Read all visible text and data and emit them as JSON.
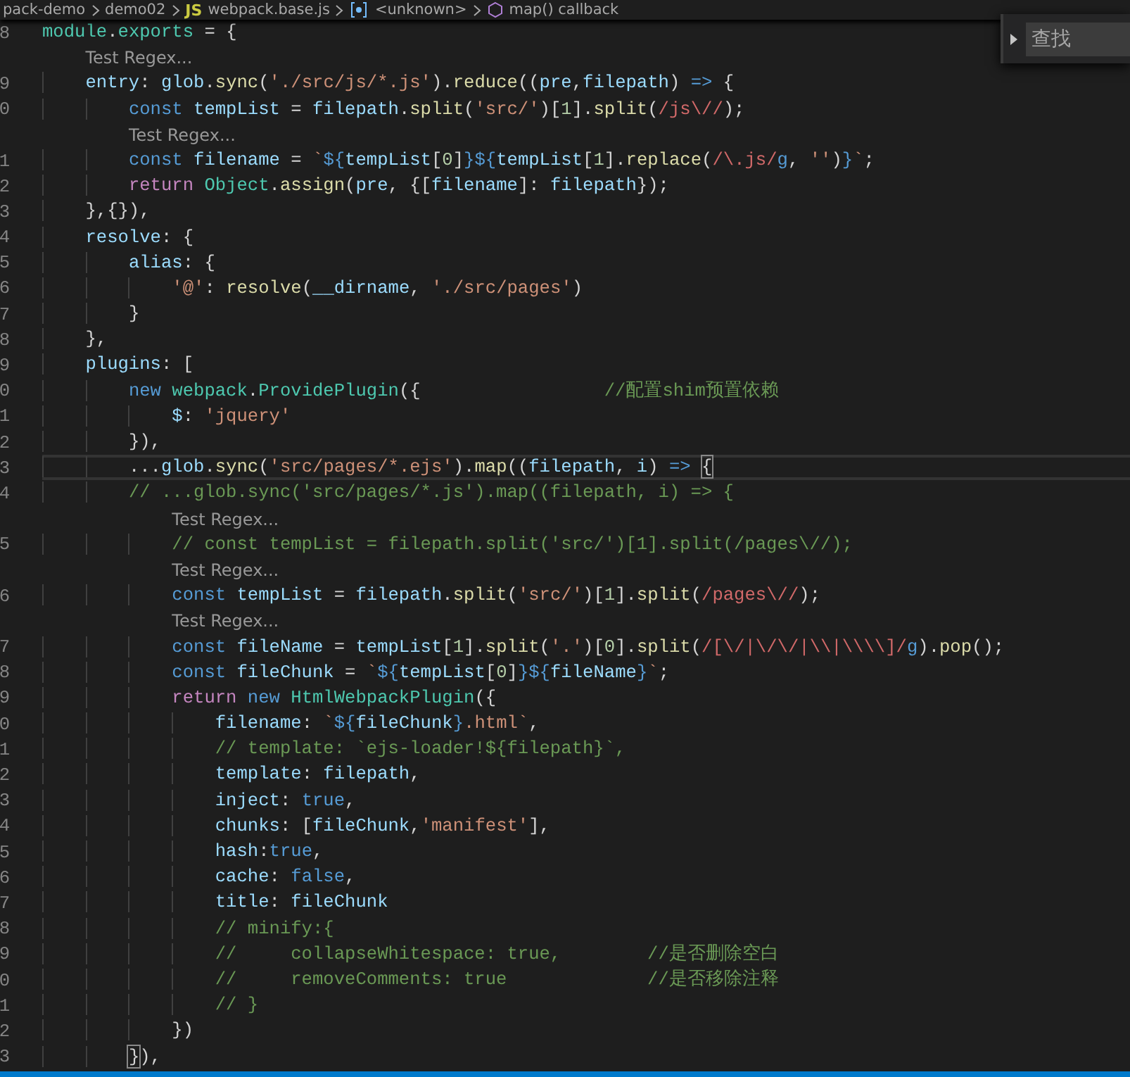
{
  "breadcrumbs": [
    {
      "label": "pack-demo",
      "kind": "folder"
    },
    {
      "label": "demo02",
      "kind": "folder"
    },
    {
      "label": "webpack.base.js",
      "kind": "file",
      "badge": "JS"
    },
    {
      "label": "<unknown>",
      "kind": "variable"
    },
    {
      "label": "map() callback",
      "kind": "method"
    }
  ],
  "editor": {
    "lines": [
      {
        "kind": "code",
        "number": "8",
        "current": false,
        "tokens": [
          {
            "text": "module",
            "kind": "cls"
          },
          {
            "text": ".",
            "kind": "p"
          },
          {
            "text": "exports",
            "kind": "cls"
          },
          {
            "text": " = {",
            "kind": "p"
          }
        ]
      },
      {
        "kind": "lens",
        "text": "Test Regex..."
      },
      {
        "kind": "code",
        "number": "9",
        "current": false,
        "tokens": [
          {
            "text": "    entry",
            "kind": "var"
          },
          {
            "text": ": ",
            "kind": "p"
          },
          {
            "text": "glob",
            "kind": "var"
          },
          {
            "text": ".",
            "kind": "p"
          },
          {
            "text": "sync",
            "kind": "fn"
          },
          {
            "text": "(",
            "kind": "p"
          },
          {
            "text": "'./src/js/*.js'",
            "kind": "str"
          },
          {
            "text": ").",
            "kind": "p"
          },
          {
            "text": "reduce",
            "kind": "fn"
          },
          {
            "text": "((",
            "kind": "p"
          },
          {
            "text": "pre",
            "kind": "var"
          },
          {
            "text": ",",
            "kind": "p"
          },
          {
            "text": "filepath",
            "kind": "var"
          },
          {
            "text": ") ",
            "kind": "p"
          },
          {
            "text": "=>",
            "kind": "kw"
          },
          {
            "text": " {",
            "kind": "p"
          }
        ]
      },
      {
        "kind": "code",
        "number": "0",
        "current": false,
        "tokens": [
          {
            "text": "        const ",
            "kind": "kw"
          },
          {
            "text": "tempList",
            "kind": "var"
          },
          {
            "text": " = ",
            "kind": "p"
          },
          {
            "text": "filepath",
            "kind": "var"
          },
          {
            "text": ".",
            "kind": "p"
          },
          {
            "text": "split",
            "kind": "fn"
          },
          {
            "text": "(",
            "kind": "p"
          },
          {
            "text": "'src/'",
            "kind": "str"
          },
          {
            "text": ")[",
            "kind": "p"
          },
          {
            "text": "1",
            "kind": "num"
          },
          {
            "text": "].",
            "kind": "p"
          },
          {
            "text": "split",
            "kind": "fn"
          },
          {
            "text": "(",
            "kind": "p"
          },
          {
            "text": "/js\\//",
            "kind": "re"
          },
          {
            "text": ");",
            "kind": "p"
          }
        ]
      },
      {
        "kind": "lens",
        "text": "Test Regex..."
      },
      {
        "kind": "code",
        "number": "1",
        "current": false,
        "tokens": [
          {
            "text": "        const ",
            "kind": "kw"
          },
          {
            "text": "filename",
            "kind": "var"
          },
          {
            "text": " = ",
            "kind": "p"
          },
          {
            "text": "`",
            "kind": "str"
          },
          {
            "text": "${",
            "kind": "kw"
          },
          {
            "text": "tempList",
            "kind": "var"
          },
          {
            "text": "[",
            "kind": "p"
          },
          {
            "text": "0",
            "kind": "num"
          },
          {
            "text": "]",
            "kind": "p"
          },
          {
            "text": "}${",
            "kind": "kw"
          },
          {
            "text": "tempList",
            "kind": "var"
          },
          {
            "text": "[",
            "kind": "p"
          },
          {
            "text": "1",
            "kind": "num"
          },
          {
            "text": "].",
            "kind": "p"
          },
          {
            "text": "replace",
            "kind": "fn"
          },
          {
            "text": "(",
            "kind": "p"
          },
          {
            "text": "/\\.js/",
            "kind": "re"
          },
          {
            "text": "g",
            "kind": "kw"
          },
          {
            "text": ", ",
            "kind": "p"
          },
          {
            "text": "''",
            "kind": "str"
          },
          {
            "text": ")",
            "kind": "p"
          },
          {
            "text": "}",
            "kind": "kw"
          },
          {
            "text": "`",
            "kind": "str"
          },
          {
            "text": ";",
            "kind": "p"
          }
        ]
      },
      {
        "kind": "code",
        "number": "2",
        "current": false,
        "tokens": [
          {
            "text": "        return ",
            "kind": "ctl"
          },
          {
            "text": "Object",
            "kind": "cls"
          },
          {
            "text": ".",
            "kind": "p"
          },
          {
            "text": "assign",
            "kind": "fn"
          },
          {
            "text": "(",
            "kind": "p"
          },
          {
            "text": "pre",
            "kind": "var"
          },
          {
            "text": ", {[",
            "kind": "p"
          },
          {
            "text": "filename",
            "kind": "var"
          },
          {
            "text": "]: ",
            "kind": "p"
          },
          {
            "text": "filepath",
            "kind": "var"
          },
          {
            "text": "});",
            "kind": "p"
          }
        ]
      },
      {
        "kind": "code",
        "number": "3",
        "current": false,
        "tokens": [
          {
            "text": "    },{}),",
            "kind": "p"
          }
        ]
      },
      {
        "kind": "code",
        "number": "4",
        "current": false,
        "tokens": [
          {
            "text": "    resolve",
            "kind": "var"
          },
          {
            "text": ": {",
            "kind": "p"
          }
        ]
      },
      {
        "kind": "code",
        "number": "5",
        "current": false,
        "tokens": [
          {
            "text": "        alias",
            "kind": "var"
          },
          {
            "text": ": {",
            "kind": "p"
          }
        ]
      },
      {
        "kind": "code",
        "number": "6",
        "current": false,
        "tokens": [
          {
            "text": "            '@'",
            "kind": "str"
          },
          {
            "text": ": ",
            "kind": "p"
          },
          {
            "text": "resolve",
            "kind": "fn"
          },
          {
            "text": "(",
            "kind": "p"
          },
          {
            "text": "__dirname",
            "kind": "var"
          },
          {
            "text": ", ",
            "kind": "p"
          },
          {
            "text": "'./src/pages'",
            "kind": "str"
          },
          {
            "text": ")",
            "kind": "p"
          }
        ]
      },
      {
        "kind": "code",
        "number": "7",
        "current": false,
        "tokens": [
          {
            "text": "        }",
            "kind": "p"
          }
        ]
      },
      {
        "kind": "code",
        "number": "8",
        "current": false,
        "tokens": [
          {
            "text": "    },",
            "kind": "p"
          }
        ]
      },
      {
        "kind": "code",
        "number": "9",
        "current": false,
        "tokens": [
          {
            "text": "    plugins",
            "kind": "var"
          },
          {
            "text": ": [",
            "kind": "p"
          }
        ]
      },
      {
        "kind": "code",
        "number": "0",
        "current": false,
        "tokens": [
          {
            "text": "        new ",
            "kind": "kw"
          },
          {
            "text": "webpack",
            "kind": "cls"
          },
          {
            "text": ".",
            "kind": "p"
          },
          {
            "text": "ProvidePlugin",
            "kind": "cls"
          },
          {
            "text": "({",
            "kind": "p"
          },
          {
            "text": "                 //配置shim预置依赖",
            "kind": "cm"
          }
        ]
      },
      {
        "kind": "code",
        "number": "1",
        "current": false,
        "tokens": [
          {
            "text": "            $",
            "kind": "var"
          },
          {
            "text": ": ",
            "kind": "p"
          },
          {
            "text": "'jquery'",
            "kind": "str"
          }
        ]
      },
      {
        "kind": "code",
        "number": "2",
        "current": false,
        "tokens": [
          {
            "text": "        }),",
            "kind": "p"
          }
        ]
      },
      {
        "kind": "code",
        "number": "3",
        "current": true,
        "tokens": [
          {
            "text": "        ...",
            "kind": "p"
          },
          {
            "text": "glob",
            "kind": "var"
          },
          {
            "text": ".",
            "kind": "p"
          },
          {
            "text": "sync",
            "kind": "fn"
          },
          {
            "text": "(",
            "kind": "p"
          },
          {
            "text": "'src/pages/*.ejs'",
            "kind": "str"
          },
          {
            "text": ").",
            "kind": "p"
          },
          {
            "text": "map",
            "kind": "fn"
          },
          {
            "text": "((",
            "kind": "p"
          },
          {
            "text": "filepath",
            "kind": "var"
          },
          {
            "text": ", ",
            "kind": "p"
          },
          {
            "text": "i",
            "kind": "var"
          },
          {
            "text": ") ",
            "kind": "p"
          },
          {
            "text": "=> ",
            "kind": "kw"
          },
          {
            "text": "{",
            "kind": "bm"
          }
        ]
      },
      {
        "kind": "code",
        "number": "4",
        "current": false,
        "tokens": [
          {
            "text": "        // ...glob.sync('src/pages/*.js').map((filepath, i) => {",
            "kind": "cm"
          }
        ]
      },
      {
        "kind": "lens",
        "text": "Test Regex..."
      },
      {
        "kind": "code",
        "number": "5",
        "current": false,
        "tokens": [
          {
            "text": "            // const tempList = filepath.split('src/')[1].split(/pages\\//);",
            "kind": "cm"
          }
        ]
      },
      {
        "kind": "lens",
        "text": "Test Regex..."
      },
      {
        "kind": "code",
        "number": "6",
        "current": false,
        "tokens": [
          {
            "text": "            const ",
            "kind": "kw"
          },
          {
            "text": "tempList",
            "kind": "var"
          },
          {
            "text": " = ",
            "kind": "p"
          },
          {
            "text": "filepath",
            "kind": "var"
          },
          {
            "text": ".",
            "kind": "p"
          },
          {
            "text": "split",
            "kind": "fn"
          },
          {
            "text": "(",
            "kind": "p"
          },
          {
            "text": "'src/'",
            "kind": "str"
          },
          {
            "text": ")[",
            "kind": "p"
          },
          {
            "text": "1",
            "kind": "num"
          },
          {
            "text": "].",
            "kind": "p"
          },
          {
            "text": "split",
            "kind": "fn"
          },
          {
            "text": "(",
            "kind": "p"
          },
          {
            "text": "/pages\\//",
            "kind": "re"
          },
          {
            "text": ");",
            "kind": "p"
          }
        ]
      },
      {
        "kind": "lens",
        "text": "Test Regex..."
      },
      {
        "kind": "code",
        "number": "7",
        "current": false,
        "tokens": [
          {
            "text": "            const ",
            "kind": "kw"
          },
          {
            "text": "fileName",
            "kind": "var"
          },
          {
            "text": " = ",
            "kind": "p"
          },
          {
            "text": "tempList",
            "kind": "var"
          },
          {
            "text": "[",
            "kind": "p"
          },
          {
            "text": "1",
            "kind": "num"
          },
          {
            "text": "].",
            "kind": "p"
          },
          {
            "text": "split",
            "kind": "fn"
          },
          {
            "text": "(",
            "kind": "p"
          },
          {
            "text": "'.'",
            "kind": "str"
          },
          {
            "text": ")[",
            "kind": "p"
          },
          {
            "text": "0",
            "kind": "num"
          },
          {
            "text": "].",
            "kind": "p"
          },
          {
            "text": "split",
            "kind": "fn"
          },
          {
            "text": "(",
            "kind": "p"
          },
          {
            "text": "/[\\/|\\/\\/|\\\\|\\\\\\\\]/",
            "kind": "re"
          },
          {
            "text": "g",
            "kind": "kw"
          },
          {
            "text": ").",
            "kind": "p"
          },
          {
            "text": "pop",
            "kind": "fn"
          },
          {
            "text": "();",
            "kind": "p"
          }
        ]
      },
      {
        "kind": "code",
        "number": "8",
        "current": false,
        "tokens": [
          {
            "text": "            const ",
            "kind": "kw"
          },
          {
            "text": "fileChunk",
            "kind": "var"
          },
          {
            "text": " = ",
            "kind": "p"
          },
          {
            "text": "`",
            "kind": "str"
          },
          {
            "text": "${",
            "kind": "kw"
          },
          {
            "text": "tempList",
            "kind": "var"
          },
          {
            "text": "[",
            "kind": "p"
          },
          {
            "text": "0",
            "kind": "num"
          },
          {
            "text": "]",
            "kind": "p"
          },
          {
            "text": "}${",
            "kind": "kw"
          },
          {
            "text": "fileName",
            "kind": "var"
          },
          {
            "text": "}",
            "kind": "kw"
          },
          {
            "text": "`",
            "kind": "str"
          },
          {
            "text": ";",
            "kind": "p"
          }
        ]
      },
      {
        "kind": "code",
        "number": "9",
        "current": false,
        "tokens": [
          {
            "text": "            return ",
            "kind": "ctl"
          },
          {
            "text": "new ",
            "kind": "kw"
          },
          {
            "text": "HtmlWebpackPlugin",
            "kind": "cls"
          },
          {
            "text": "({",
            "kind": "p"
          }
        ]
      },
      {
        "kind": "code",
        "number": "0",
        "current": false,
        "tokens": [
          {
            "text": "                filename",
            "kind": "var"
          },
          {
            "text": ": ",
            "kind": "p"
          },
          {
            "text": "`",
            "kind": "str"
          },
          {
            "text": "${",
            "kind": "kw"
          },
          {
            "text": "fileChunk",
            "kind": "var"
          },
          {
            "text": "}",
            "kind": "kw"
          },
          {
            "text": ".html`",
            "kind": "str"
          },
          {
            "text": ",",
            "kind": "p"
          }
        ]
      },
      {
        "kind": "code",
        "number": "1",
        "current": false,
        "tokens": [
          {
            "text": "                // template: `ejs-loader!${filepath}`,",
            "kind": "cm"
          }
        ]
      },
      {
        "kind": "code",
        "number": "2",
        "current": false,
        "tokens": [
          {
            "text": "                template",
            "kind": "var"
          },
          {
            "text": ": ",
            "kind": "p"
          },
          {
            "text": "filepath",
            "kind": "var"
          },
          {
            "text": ",",
            "kind": "p"
          }
        ]
      },
      {
        "kind": "code",
        "number": "3",
        "current": false,
        "tokens": [
          {
            "text": "                inject",
            "kind": "var"
          },
          {
            "text": ": ",
            "kind": "p"
          },
          {
            "text": "true",
            "kind": "kw"
          },
          {
            "text": ",",
            "kind": "p"
          }
        ]
      },
      {
        "kind": "code",
        "number": "4",
        "current": false,
        "tokens": [
          {
            "text": "                chunks",
            "kind": "var"
          },
          {
            "text": ": [",
            "kind": "p"
          },
          {
            "text": "fileChunk",
            "kind": "var"
          },
          {
            "text": ",",
            "kind": "p"
          },
          {
            "text": "'manifest'",
            "kind": "str"
          },
          {
            "text": "],",
            "kind": "p"
          }
        ]
      },
      {
        "kind": "code",
        "number": "5",
        "current": false,
        "tokens": [
          {
            "text": "                hash",
            "kind": "var"
          },
          {
            "text": ":",
            "kind": "p"
          },
          {
            "text": "true",
            "kind": "kw"
          },
          {
            "text": ",",
            "kind": "p"
          }
        ]
      },
      {
        "kind": "code",
        "number": "6",
        "current": false,
        "tokens": [
          {
            "text": "                cache",
            "kind": "var"
          },
          {
            "text": ": ",
            "kind": "p"
          },
          {
            "text": "false",
            "kind": "kw"
          },
          {
            "text": ",",
            "kind": "p"
          }
        ]
      },
      {
        "kind": "code",
        "number": "7",
        "current": false,
        "tokens": [
          {
            "text": "                title",
            "kind": "var"
          },
          {
            "text": ": ",
            "kind": "p"
          },
          {
            "text": "fileChunk",
            "kind": "var"
          }
        ]
      },
      {
        "kind": "code",
        "number": "8",
        "current": false,
        "tokens": [
          {
            "text": "                // minify:{",
            "kind": "cm"
          }
        ]
      },
      {
        "kind": "code",
        "number": "9",
        "current": false,
        "tokens": [
          {
            "text": "                //     collapseWhitespace: true,        //是否删除空白",
            "kind": "cm"
          }
        ]
      },
      {
        "kind": "code",
        "number": "0",
        "current": false,
        "tokens": [
          {
            "text": "                //     removeComments: true             //是否移除注释",
            "kind": "cm"
          }
        ]
      },
      {
        "kind": "code",
        "number": "1",
        "current": false,
        "tokens": [
          {
            "text": "                // }",
            "kind": "cm"
          }
        ]
      },
      {
        "kind": "code",
        "number": "2",
        "current": false,
        "tokens": [
          {
            "text": "            })",
            "kind": "p"
          }
        ]
      },
      {
        "kind": "code",
        "number": "3",
        "current": false,
        "tokens": [
          {
            "text": "        }",
            "kind": "bm"
          },
          {
            "text": "),",
            "kind": "p"
          }
        ]
      }
    ]
  },
  "find_widget": {
    "placeholder": "查找",
    "replace_expanded": false
  }
}
